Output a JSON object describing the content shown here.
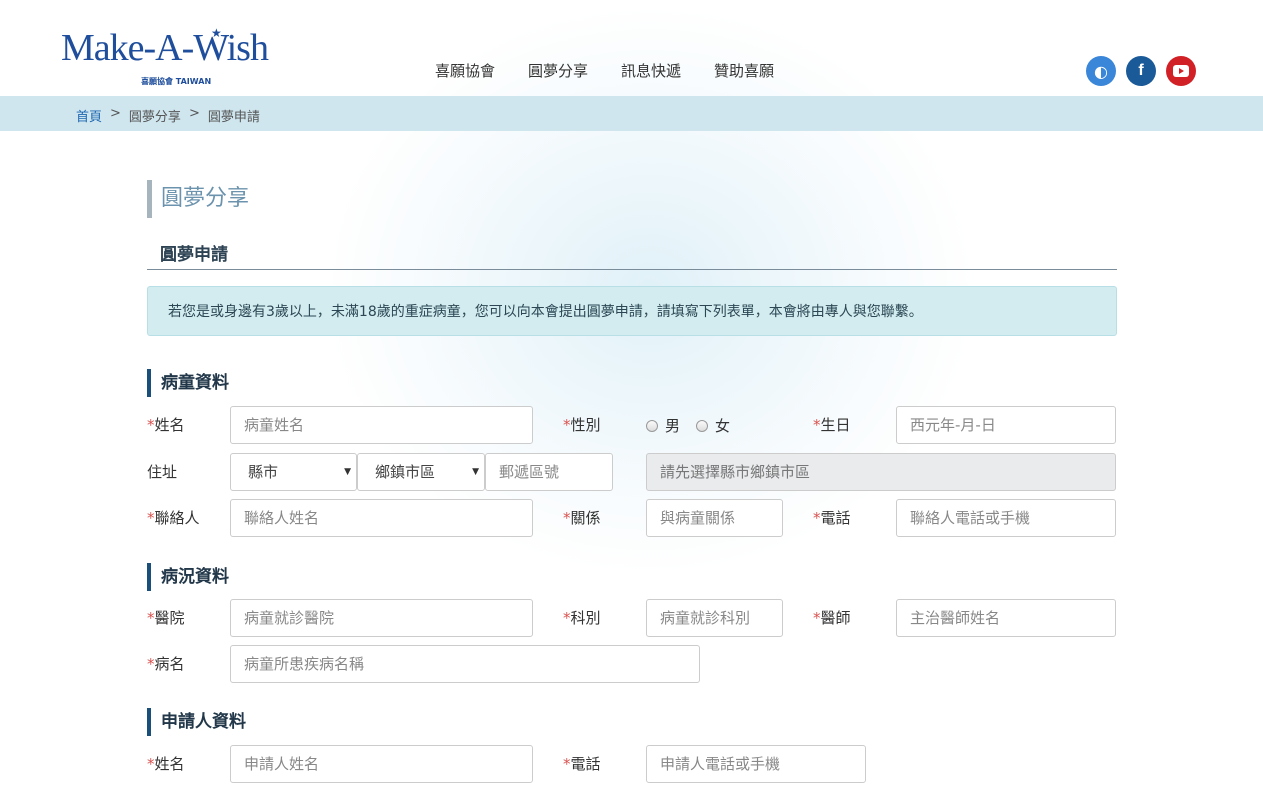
{
  "logo": {
    "main": "Make-A-Wish",
    "sub": "喜願協會 TAIWAN"
  },
  "nav": [
    "喜願協會",
    "圓夢分享",
    "訊息快遞",
    "贊助喜願"
  ],
  "social": {
    "icons": [
      "wish-icon",
      "facebook-icon",
      "youtube-icon"
    ],
    "facebook_glyph": "f",
    "youtube_glyph": "▶",
    "wish_glyph": "◐"
  },
  "breadcrumb": {
    "home": "首頁",
    "sep": ">",
    "level1": "圓夢分享",
    "level2": "圓夢申請"
  },
  "page_title": "圓夢分享",
  "sub_title": "圓夢申請",
  "notice": "若您是或身邊有3歲以上，未滿18歲的重症病童，您可以向本會提出圓夢申請，請填寫下列表單，本會將由專人與您聯繫。",
  "sections": {
    "child": "病童資料",
    "condition": "病況資料",
    "applicant": "申請人資料"
  },
  "required_mark": "*",
  "child": {
    "name_label": "姓名",
    "name_placeholder": "病童姓名",
    "gender_label": "性別",
    "gender_male": "男",
    "gender_female": "女",
    "birthday_label": "生日",
    "birthday_placeholder": "西元年-月-日",
    "address_label": "住址",
    "county_select": "縣市",
    "district_select": "鄉鎮市區",
    "zip_placeholder": "郵遞區號",
    "address_placeholder": "請先選擇縣市鄉鎮市區",
    "contact_label": "聯絡人",
    "contact_placeholder": "聯絡人姓名",
    "relation_label": "關係",
    "relation_placeholder": "與病童關係",
    "phone_label": "電話",
    "phone_placeholder": "聯絡人電話或手機"
  },
  "condition": {
    "hospital_label": "醫院",
    "hospital_placeholder": "病童就診醫院",
    "dept_label": "科別",
    "dept_placeholder": "病童就診科別",
    "doctor_label": "醫師",
    "doctor_placeholder": "主治醫師姓名",
    "disease_label": "病名",
    "disease_placeholder": "病童所患疾病名稱"
  },
  "applicant": {
    "name_label": "姓名",
    "name_placeholder": "申請人姓名",
    "phone_label": "電話",
    "phone_placeholder": "申請人電話或手機"
  },
  "colors": {
    "brand": "#1f4e9c",
    "breadcrumb_bg": "#cfe6ef",
    "notice_bg": "#d2ecef",
    "required": "#d9534f",
    "section_bar": "#1a4f7a"
  }
}
